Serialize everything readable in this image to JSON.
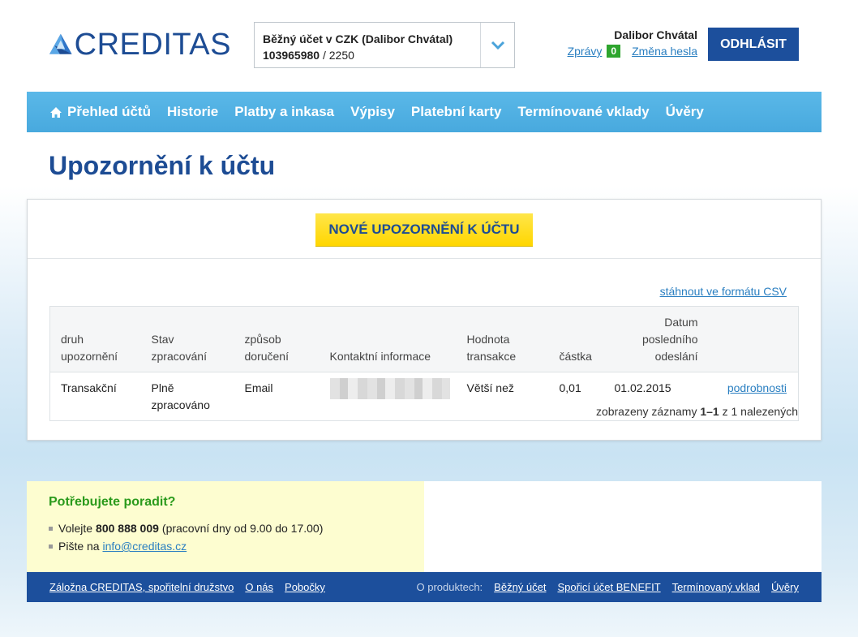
{
  "header": {
    "logo_text": "CREDITAS",
    "account": {
      "name": "Běžný účet v CZK (Dalibor Chvátal)",
      "number": "103965980",
      "bank_code": " / 2250"
    },
    "user_name": "Dalibor Chvátal",
    "messages_label": "Zprávy",
    "messages_count": "0",
    "change_password_label": "Změna hesla",
    "logout_label": "ODHLÁSIT"
  },
  "nav": {
    "items": [
      "Přehled účtů",
      "Historie",
      "Platby a inkasa",
      "Výpisy",
      "Platební karty",
      "Termínované vklady",
      "Úvěry"
    ]
  },
  "page_title": "Upozornění k účtu",
  "main": {
    "new_button_label": "NOVÉ UPOZORNĚNÍ K ÚČTU",
    "csv_link_label": "stáhnout ve formátu CSV",
    "table": {
      "headers": [
        "druh upozornění",
        "Stav zpracování",
        "způsob doručení",
        "Kontaktní informace",
        "Hodnota transakce",
        "částka",
        "Datum posledního odeslání",
        ""
      ],
      "rows": [
        {
          "type": "Transakční",
          "status": "Plně zpracováno",
          "delivery": "Email",
          "contact": "",
          "condition": "Větší než",
          "amount": "0,01",
          "date": "01.02.2015",
          "details_label": "podrobnosti"
        }
      ]
    },
    "pager": {
      "prefix": "zobrazeny záznamy ",
      "range": "1–1",
      "mid": " z ",
      "total": "1",
      "suffix": " nalezených"
    }
  },
  "help": {
    "title": "Potřebujete poradit?",
    "call_prefix": "Volejte",
    "phone": "800 888 009",
    "call_suffix": "(pracovní dny od 9.00 do 17.00)",
    "write_prefix": "Pište na",
    "email": "info@creditas.cz"
  },
  "footer": {
    "left_links": [
      "Záložna CREDITAS, spořitelní družstvo",
      "O nás",
      "Pobočky"
    ],
    "products_label": "O produktech:",
    "product_links": [
      "Běžný účet",
      "Spořicí účet BENEFIT",
      "Termínovaný vklad",
      "Úvěry"
    ]
  },
  "colors": {
    "brand_blue": "#1d4c94",
    "nav_blue": "#4fb0e3",
    "accent_yellow": "#ffe01a",
    "help_green": "#2a9a1c",
    "link_blue": "#2a7fc1"
  }
}
